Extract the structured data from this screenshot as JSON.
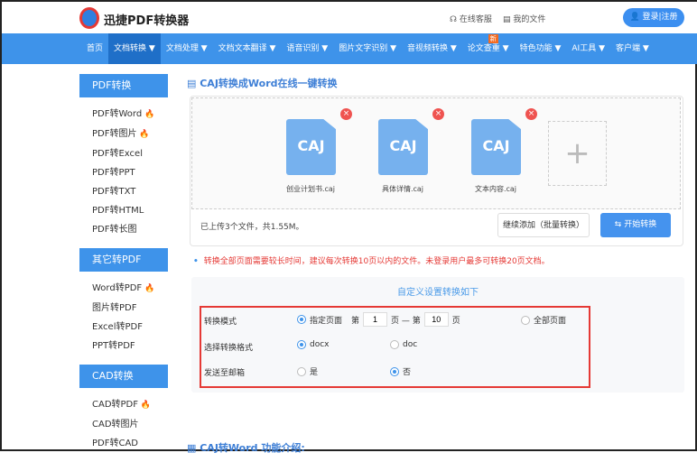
{
  "header": {
    "brand": "迅捷PDF转换器",
    "service": "在线客服",
    "myfiles": "我的文件",
    "login": "登录|注册"
  },
  "nav": [
    {
      "label": "首页"
    },
    {
      "label": "文档转换 ▼",
      "active": true
    },
    {
      "label": "文档处理 ▼"
    },
    {
      "label": "文档文本翻译 ▼"
    },
    {
      "label": "语音识别 ▼"
    },
    {
      "label": "图片文字识别 ▼"
    },
    {
      "label": "音视频转换 ▼"
    },
    {
      "label": "论文查重 ▼",
      "badge": "新"
    },
    {
      "label": "特色功能 ▼"
    },
    {
      "label": "AI工具 ▼"
    },
    {
      "label": "客户端 ▼"
    }
  ],
  "sidebar": [
    {
      "heading": "PDF转换",
      "items": [
        {
          "label": "PDF转Word",
          "hot": true
        },
        {
          "label": "PDF转图片",
          "hot": true
        },
        {
          "label": "PDF转Excel"
        },
        {
          "label": "PDF转PPT"
        },
        {
          "label": "PDF转TXT"
        },
        {
          "label": "PDF转HTML"
        },
        {
          "label": "PDF转长图"
        }
      ]
    },
    {
      "heading": "其它转PDF",
      "items": [
        {
          "label": "Word转PDF",
          "hot": true
        },
        {
          "label": "图片转PDF"
        },
        {
          "label": "Excel转PDF"
        },
        {
          "label": "PPT转PDF"
        }
      ]
    },
    {
      "heading": "CAD转换",
      "items": [
        {
          "label": "CAD转PDF",
          "hot": true
        },
        {
          "label": "CAD转图片"
        },
        {
          "label": "PDF转CAD"
        }
      ]
    }
  ],
  "main": {
    "title": "CAJ转换成Word在线一键转换",
    "files": [
      {
        "type": "CAJ",
        "name": "创业计划书.caj"
      },
      {
        "type": "CAJ",
        "name": "具体详情.caj"
      },
      {
        "type": "CAJ",
        "name": "文本内容.caj"
      }
    ],
    "upload_status": "已上传3个文件，共1.55M。",
    "add_more": "继续添加（批量转换）",
    "start": "开始转换",
    "note": "转换全部页面需要较长时间，建议每次转换10页以内的文件。未登录用户最多可转换20页文档。",
    "settings": {
      "title": "自定义设置转换如下",
      "mode_label": "转换模式",
      "mode_specific": "指定页面",
      "from_prefix": "第",
      "from": "1",
      "mid": "页 — 第",
      "to": "10",
      "to_suffix": "页",
      "mode_all": "全部页面",
      "format_label": "选择转换格式",
      "docx": "docx",
      "doc": "doc",
      "email_label": "发送至邮箱",
      "yes": "是",
      "no": "否",
      "selected": {
        "mode": "指定页面",
        "format": "docx",
        "email": "否"
      }
    },
    "intro_heading": "CAJ转Word 功能介绍:"
  },
  "colors": {
    "primary": "#3e93ea",
    "warning": "#e53935",
    "hot": "#f46b21"
  }
}
